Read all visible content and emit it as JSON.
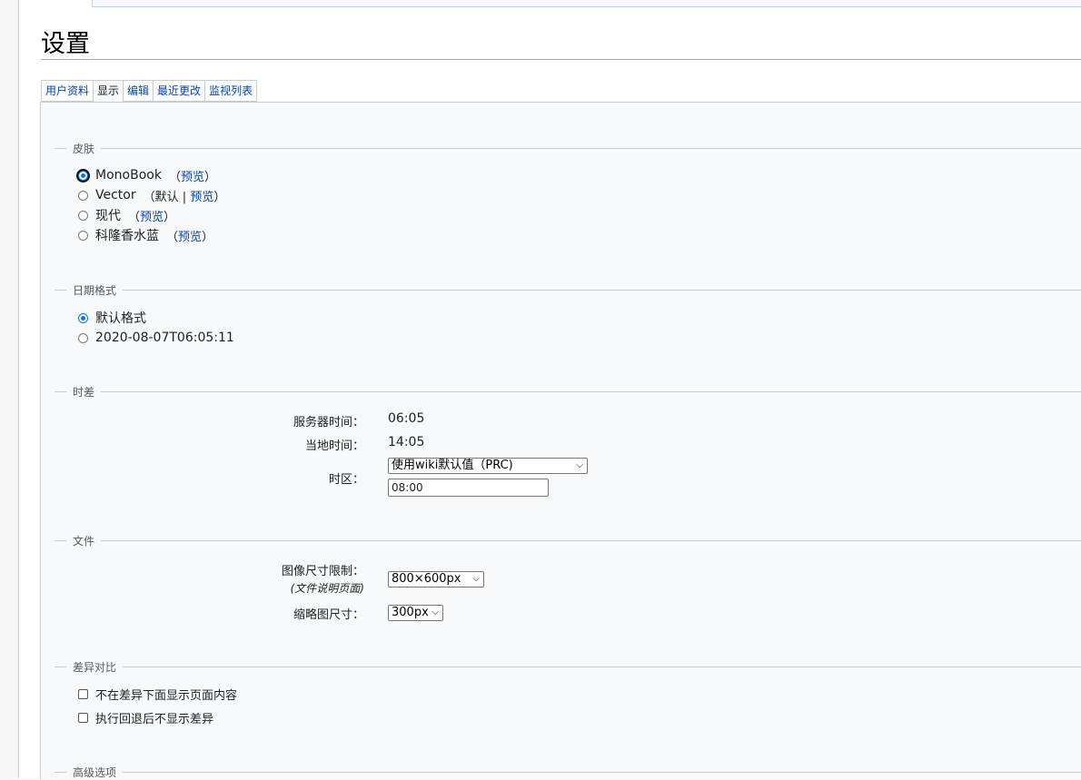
{
  "page": {
    "title": "设置"
  },
  "tabs": [
    {
      "label": "用户资料",
      "active": false
    },
    {
      "label": "显示",
      "active": true
    },
    {
      "label": "编辑",
      "active": false
    },
    {
      "label": "最近更改",
      "active": false
    },
    {
      "label": "监视列表",
      "active": false
    }
  ],
  "skin": {
    "legend": "皮肤",
    "options": [
      {
        "label": "MonoBook",
        "selected": true,
        "open": "（",
        "preview": "预览",
        "close": "）"
      },
      {
        "label": "Vector",
        "selected": false,
        "open": "（",
        "default": "默认",
        "sep": "|",
        "preview": "预览",
        "close": "）"
      },
      {
        "label": "现代",
        "selected": false,
        "open": "（",
        "preview": "预览",
        "close": "）"
      },
      {
        "label": "科隆香水蓝",
        "selected": false,
        "open": "（",
        "preview": "预览",
        "close": "）"
      }
    ]
  },
  "date_format": {
    "legend": "日期格式",
    "options": [
      {
        "label": "默认格式",
        "selected": true
      },
      {
        "label": "2020-08-07T06:05:11",
        "selected": false
      }
    ]
  },
  "time_offset": {
    "legend": "时差",
    "server_time_label": "服务器时间：",
    "server_time_value": "06:05",
    "local_time_label": "当地时间：",
    "local_time_value": "14:05",
    "timezone_label": "时区：",
    "timezone_select": "使用wiki默认值（PRC)",
    "timezone_offset": "08:00"
  },
  "files": {
    "legend": "文件",
    "image_limit_label": "图像尺寸限制：",
    "image_limit_sublabel": "(文件说明页面)",
    "image_limit_value": "800×600px",
    "thumb_label": "缩略图尺寸：",
    "thumb_value": "300px"
  },
  "diffs": {
    "legend": "差异对比",
    "options": [
      {
        "label": "不在差异下面显示页面内容",
        "checked": false
      },
      {
        "label": "执行回退后不显示差异",
        "checked": false
      }
    ]
  },
  "advanced": {
    "legend": "高级选项"
  },
  "colors": {
    "link": "#0645ad",
    "radio_selected": "#0075ff"
  },
  "icons": {
    "select_arrow": "chevron-down-icon"
  }
}
